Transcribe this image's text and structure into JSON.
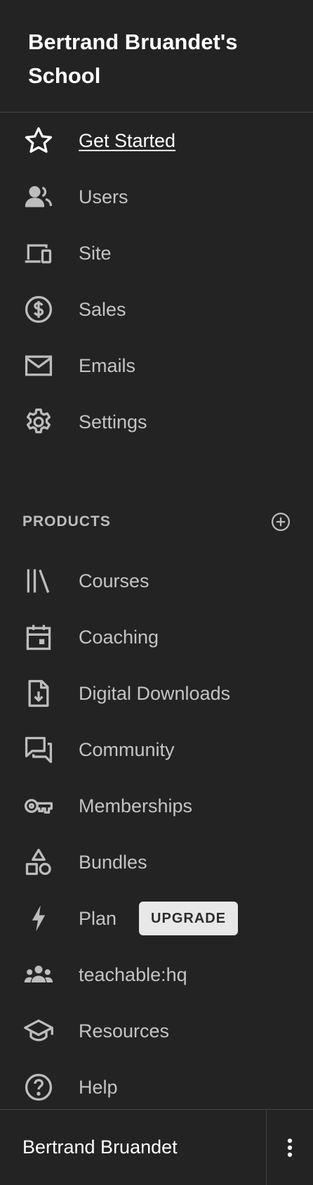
{
  "header": {
    "school_name": "Bertrand Bruandet's School"
  },
  "nav_main": [
    {
      "label": "Get Started",
      "icon": "star-icon",
      "active": true
    },
    {
      "label": "Users",
      "icon": "users-icon"
    },
    {
      "label": "Site",
      "icon": "devices-icon"
    },
    {
      "label": "Sales",
      "icon": "dollar-icon"
    },
    {
      "label": "Emails",
      "icon": "mail-icon"
    },
    {
      "label": "Settings",
      "icon": "gear-icon"
    }
  ],
  "products_section": {
    "title": "PRODUCTS",
    "add_icon": "plus-circle-icon"
  },
  "nav_products": [
    {
      "label": "Courses",
      "icon": "library-icon"
    },
    {
      "label": "Coaching",
      "icon": "calendar-icon"
    },
    {
      "label": "Digital Downloads",
      "icon": "file-download-icon"
    },
    {
      "label": "Community",
      "icon": "chat-icon"
    },
    {
      "label": "Memberships",
      "icon": "key-icon"
    },
    {
      "label": "Bundles",
      "icon": "shapes-icon"
    },
    {
      "label": "Plan",
      "icon": "bolt-icon",
      "badge": "UPGRADE"
    },
    {
      "label": "teachable:hq",
      "icon": "group-icon"
    },
    {
      "label": "Resources",
      "icon": "graduation-cap-icon"
    },
    {
      "label": "Help",
      "icon": "help-icon"
    }
  ],
  "footer": {
    "user_name": "Bertrand Bruandet",
    "menu_icon": "more-vertical-icon"
  },
  "colors": {
    "background": "#232323",
    "text": "#c4c4c4",
    "active_text": "#ffffff",
    "badge_bg": "#e8e8e8"
  }
}
